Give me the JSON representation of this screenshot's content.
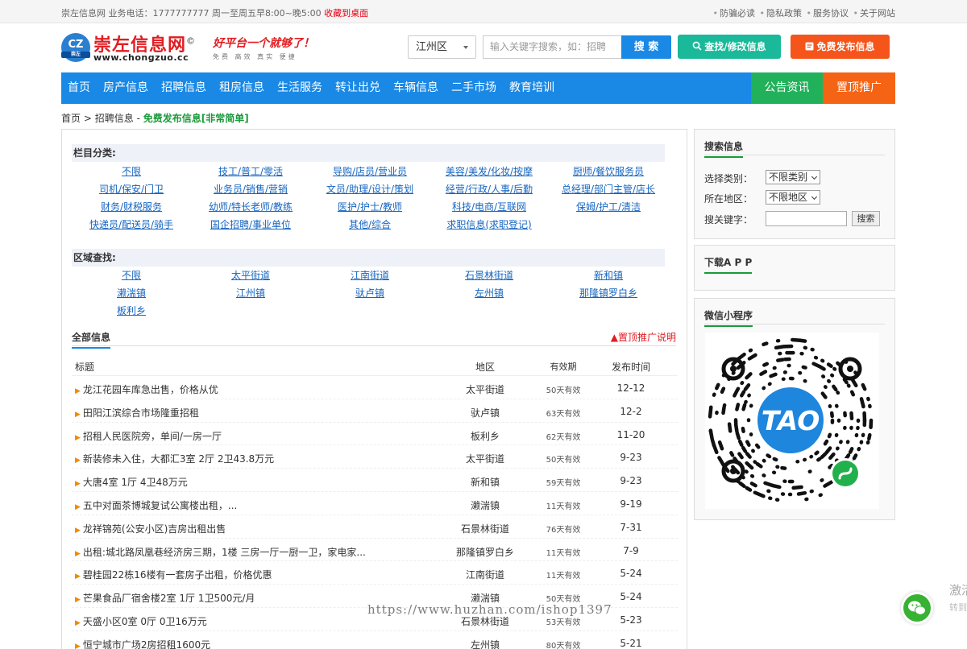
{
  "topbar": {
    "left": "崇左信息网 业务电话：1777777777 周一至周五早8:00~晚5:00",
    "fav": "收藏到桌面",
    "links": [
      "防骗必读",
      "隐私政策",
      "服务协议",
      "关于网站"
    ]
  },
  "logo": {
    "badge": "CZ",
    "badge_sub": "崇左",
    "name": "崇左信息网",
    "reg": "©",
    "url": "www.chongzuo.cc"
  },
  "slogan": {
    "main": "好平台一个就够了！",
    "sub": "免费 高效 真实 便捷"
  },
  "search": {
    "region": "江州区",
    "placeholder": "输入关键字搜索，如：招聘",
    "button": "搜 索"
  },
  "buttons": {
    "query": "查找/修改信息",
    "post": "免费发布信息"
  },
  "nav": {
    "items": [
      "首页",
      "房产信息",
      "招聘信息",
      "租房信息",
      "生活服务",
      "转让出兑",
      "车辆信息",
      "二手市场",
      "教育培训"
    ],
    "notice": "公告资讯",
    "promote": "置顶推广"
  },
  "breadcrumb": {
    "home": "首页",
    "sep": ">",
    "current": "招聘信息",
    "dash": "-",
    "post": "免费发布信息[非常简单]"
  },
  "categories": {
    "title": "栏目分类:",
    "items": [
      "不限",
      "技工/普工/零活",
      "导购/店员/营业员",
      "美容/美发/化妆/按摩",
      "厨师/餐饮服务员",
      "司机/保安/门卫",
      "业务员/销售/营销",
      "文员/助理/设计/策划",
      "经营/行政/人事/后勤",
      "总经理/部门主管/店长",
      "财务/财税服务",
      "幼师/特长老师/教练",
      "医护/护士/教师",
      "科技/电商/互联网",
      "保姆/护工/清洁",
      "快递员/配送员/骑手",
      "国企招聘/事业单位",
      "其他/综合",
      "求职信息(求职登记)"
    ]
  },
  "areas": {
    "title": "区域查找:",
    "items": [
      "不限",
      "太平街道",
      "江南街道",
      "石景林街道",
      "新和镇",
      "濑湍镇",
      "江州镇",
      "驮卢镇",
      "左州镇",
      "那隆镇罗白乡",
      "板利乡"
    ]
  },
  "all_info": {
    "title": "全部信息",
    "adv": "▲置顶推广说明"
  },
  "table": {
    "headers": {
      "title": "标题",
      "region": "地区",
      "valid": "有效期",
      "date": "发布时间"
    },
    "rows": [
      {
        "title": "龙江花园车库急出售，价格从优",
        "region": "太平街道",
        "valid": "50天有效",
        "date": "12-12"
      },
      {
        "title": "田阳江滨综合市场隆重招租",
        "region": "驮卢镇",
        "valid": "63天有效",
        "date": "12-2"
      },
      {
        "title": "招租人民医院旁，单间/一房一厅",
        "region": "板利乡",
        "valid": "62天有效",
        "date": "11-20"
      },
      {
        "title": "新装修未入住，大都汇3室 2厅 2卫43.8万元",
        "region": "太平街道",
        "valid": "50天有效",
        "date": "9-23"
      },
      {
        "title": "大唐4室 1厅 4卫48万元",
        "region": "新和镇",
        "valid": "59天有效",
        "date": "9-23"
      },
      {
        "title": "五中对面茶博城复试公寓楼出租，...",
        "region": "濑湍镇",
        "valid": "11天有效",
        "date": "9-19"
      },
      {
        "title": "龙祥锦苑(公安小区)吉房出租出售",
        "region": "石景林街道",
        "valid": "76天有效",
        "date": "7-31"
      },
      {
        "title": "出租:城北路凤凰巷经济房三期，1楼 三房一厅一厨一卫，家电家...",
        "region": "那隆镇罗白乡",
        "valid": "11天有效",
        "date": "7-9"
      },
      {
        "title": "碧桂园22栋16楼有一套房子出租，价格优惠",
        "region": "江南街道",
        "valid": "11天有效",
        "date": "5-24"
      },
      {
        "title": "芒果食品厂宿舍楼2室 1厅 1卫500元/月",
        "region": "濑湍镇",
        "valid": "50天有效",
        "date": "5-24"
      },
      {
        "title": "天盛小区0室 0厅 0卫16万元",
        "region": "石景林街道",
        "valid": "53天有效",
        "date": "5-23"
      },
      {
        "title": "恒宁城市广场2房招租1600元",
        "region": "左州镇",
        "valid": "80天有效",
        "date": "5-21"
      }
    ]
  },
  "sidebar": {
    "search": {
      "title": "搜索信息",
      "category_label": "选择类别：",
      "category_value": "不限类别",
      "area_label": "所在地区：",
      "area_value": "不限地区",
      "keyword_label": "搜关键字：",
      "button": "搜索"
    },
    "app": {
      "title": "下载A P P"
    },
    "miniprogram": {
      "title": "微信小程序",
      "logo_text": "TAO"
    }
  },
  "watermark": "https://www.huzhan.com/ishop1397",
  "float": {
    "tip1": "激活",
    "tip2": "转到"
  },
  "colors": {
    "primary": "#1a88e5",
    "green": "#20b15a",
    "orange": "#f56314",
    "teal": "#19b99a",
    "red": "#e11d21"
  }
}
